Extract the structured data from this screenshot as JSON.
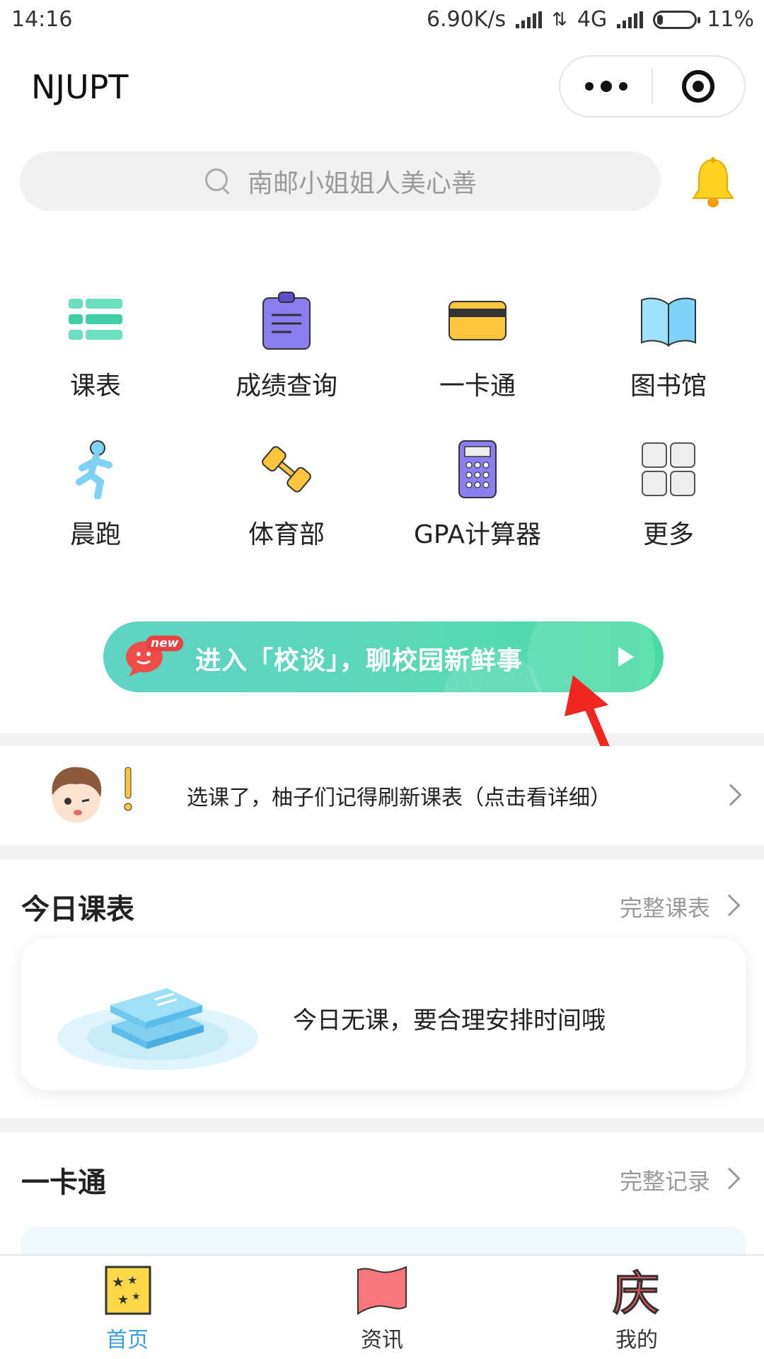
{
  "status_bar": {
    "time": "14:16",
    "net_speed": "6.90K/s",
    "network": "4G",
    "battery": "11%"
  },
  "nav": {
    "title": "NJUPT"
  },
  "search": {
    "placeholder": "南邮小姐姐人美心善"
  },
  "grid": {
    "items": [
      {
        "label": "课表",
        "icon": "schedule-icon"
      },
      {
        "label": "成绩查询",
        "icon": "grades-clipboard-icon"
      },
      {
        "label": "一卡通",
        "icon": "card-icon"
      },
      {
        "label": "图书馆",
        "icon": "book-icon"
      },
      {
        "label": "晨跑",
        "icon": "runner-icon"
      },
      {
        "label": "体育部",
        "icon": "dumbbell-icon"
      },
      {
        "label": "GPA计算器",
        "icon": "calculator-icon"
      },
      {
        "label": "更多",
        "icon": "more-grid-icon"
      }
    ]
  },
  "banner": {
    "tag": "new",
    "text": "进入「校谈」，聊校园新鲜事"
  },
  "notice": {
    "text": "选课了，柚子们记得刷新课表（点击看详细）"
  },
  "today_schedule": {
    "title": "今日课表",
    "link": "完整课表",
    "empty_text": "今日无课，要合理安排时间哦"
  },
  "campus_card": {
    "title": "一卡通",
    "link": "完整记录"
  },
  "tabbar": {
    "tabs": [
      {
        "label": "首页",
        "active": true
      },
      {
        "label": "资讯",
        "active": false
      },
      {
        "label": "我的",
        "active": false
      }
    ]
  },
  "colors": {
    "accent": "#3a9ee6",
    "banner_start": "#5fd3c4",
    "banner_end": "#49dba3"
  }
}
